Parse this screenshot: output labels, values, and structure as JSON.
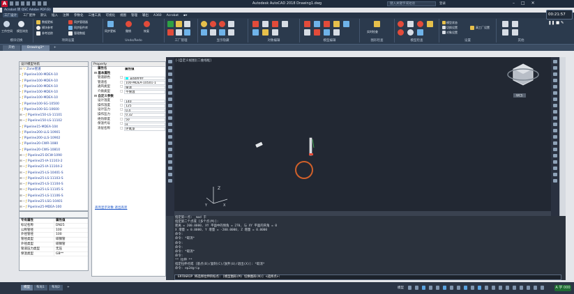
{
  "window": {
    "title": "Autodesk AutoCAD 2018   Drawing1.dwg",
    "search_placeholder": "键入关键字或短语",
    "user": "登录",
    "account_tab": "Acrobat 转 QSC   Adobe PDF(B)"
  },
  "menubar": {
    "items": [
      "工厂设计",
      "工厂配件",
      "默认",
      "插入",
      "注释",
      "参数化",
      "三维工具",
      "可视化",
      "视图",
      "管理",
      "输出",
      "A360",
      "Acrobat"
    ]
  },
  "ribbon": {
    "groups": [
      {
        "label": "模块切换",
        "buttons": [
          "工作空间",
          "模型浏览"
        ]
      },
      {
        "label": "项目设置",
        "buttons": [
          "数据更新",
          "模块参考",
          "参考追踪",
          "同步管理器",
          "同步配件库",
          "管理数据"
        ]
      },
      {
        "label": "Undo/Redo",
        "buttons": [
          "同步更新",
          "撤销",
          "恢复"
        ]
      },
      {
        "label": "工厂管理",
        "buttons": []
      },
      {
        "label": "显示隐藏",
        "buttons": []
      },
      {
        "label": "对象编辑",
        "buttons": []
      },
      {
        "label": "模型编辑",
        "buttons": []
      },
      {
        "label": "图形检查",
        "buttons": [
          "实时检查"
        ]
      },
      {
        "label": "模型检查",
        "buttons": []
      },
      {
        "label": "设置",
        "buttons": [
          "模型状态",
          "切换设置",
          "对象设置",
          "高工厂设置"
        ]
      },
      {
        "label": "其他",
        "buttons": []
      }
    ],
    "timer": "00:21:57"
  },
  "doc_tabs": [
    "开始",
    "Drawing1*",
    "+"
  ],
  "tree": {
    "header": "设计模型导航",
    "root": "Zone管道",
    "items": [
      "Pipeline100-MDEA-10",
      "Pipeline100-MDEA-10",
      "Pipeline100-MDEA-10",
      "Pipeline100-MDEA-10",
      "Pipeline100-MDEA-10",
      "Pipeline100-SG-10500",
      "Pipeline100-SG-10600",
      "Pipeline150-LS-11101",
      "Pipeline150-LS-11102",
      "Pipeline15-MDEA-104",
      "Pipeline200-LLS-10901",
      "Pipeline200-LLS-10902",
      "Pipeline20-CWR-1080",
      "Pipeline20-CWS-10810",
      "Pipeline25-DCW-1090",
      "Pipeline25-IA-11103-2",
      "Pipeline25-IA-11104-2",
      "Pipeline25-LS-10401-S",
      "Pipeline25-LS-11103-S",
      "Pipeline25-LS-11104-S",
      "Pipeline25-LS-11105-S",
      "Pipeline25-LS-11106-S",
      "Pipeline25-LSG-10401",
      "Pipeline25-MDEA-100",
      "Pipeline25-MDEA-100"
    ]
  },
  "attr_table": {
    "header": [
      "专有属性",
      "属性值"
    ],
    "rows": [
      [
        "专有属性",
        "属性值"
      ],
      [
        "标记名称",
        "DN25"
      ],
      [
        "公称管径",
        "100"
      ],
      [
        "外径管径",
        "100"
      ],
      [
        "管径类型",
        "碳钢管"
      ],
      [
        "外径类型",
        "碳钢管"
      ],
      [
        "管道压力类型",
        "无压"
      ],
      [
        "保温类型",
        "GB**"
      ]
    ]
  },
  "property": {
    "title": "Property",
    "col_name": "属性名",
    "col_value": "属性值",
    "sections": [
      {
        "name": "基本属性",
        "rows": [
          [
            "管道颜色",
            "□",
            "#00FFFF"
          ],
          [
            "管道名",
            "□",
            "100-MDEA-10501-1"
          ],
          [
            "通风类型",
            "□",
            "保温"
          ],
          [
            "介质类型",
            "□",
            "不保温"
          ]
        ]
      },
      {
        "name": "自定义参数",
        "rows": [
          [
            "设计温度",
            "□",
            "140"
          ],
          [
            "操作温度",
            "□",
            "125"
          ],
          [
            "设计压力",
            "□",
            "0.4"
          ],
          [
            "操作压力",
            "□",
            "0.32"
          ],
          [
            "绝热厚度",
            "□",
            "50"
          ],
          [
            "保温代号",
            "□",
            "H"
          ],
          [
            "涂层名称",
            "□",
            "环氧漆"
          ]
        ]
      }
    ],
    "links": [
      "高亮显示对象  退出高亮"
    ]
  },
  "canvas": {
    "label": "[-]自定义视图][二维线框]",
    "cube_label": "WCS",
    "axis_z": "Z",
    "axis_y": "Y",
    "axis_x": "X"
  },
  "command": {
    "lines": [
      "指定第一点: _mod 于",
      "指定第二个点或 [多个点(M)]:",
      "距离 = 200.0000, XY 平面中的倾角 = 270,   与 XY 平面的夹角 = 0",
      "X 增量 = 0.0000,   Y 增量 = -200.0000,   Z 增量 = 0.0000",
      "命令:",
      "命令: *取消*",
      "命令:",
      "命令:",
      "命令: *取消*",
      "命令:",
      "** 拉伸 **",
      "指定拉伸点或 [基点(B)/复制(C)/放弃(U)/退出(X)]: *取消*",
      "命令: ep2dgrip"
    ],
    "input": "ERTDGRIP 将选择拉伸目标点: [模型图形(M) 切换图形(N)] <选择点>:"
  },
  "layout_tabs": [
    "模型",
    "布局1",
    "布局2",
    "+"
  ],
  "status": {
    "badge": "A 学 000",
    "model": "模型"
  }
}
